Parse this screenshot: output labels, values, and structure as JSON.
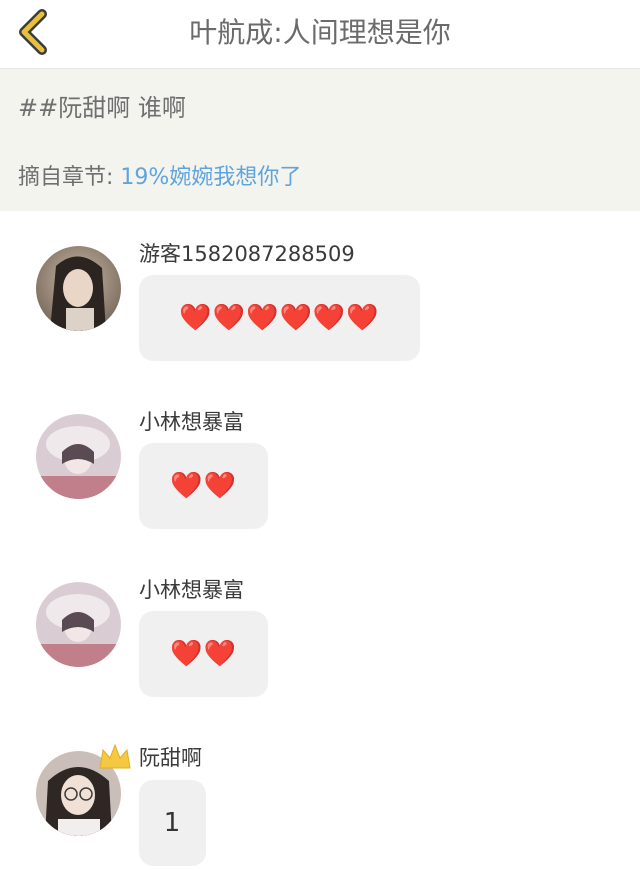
{
  "header": {
    "title": "叶航成:人间理想是你",
    "back_icon": "chevron-left-icon",
    "accent_color": "#e8c13a"
  },
  "quote": {
    "text": "##阮甜啊 谁啊",
    "chapter_label": "摘自章节:",
    "chapter_title": "19%婉婉我想你了"
  },
  "comments": [
    {
      "username": "游客1582087288509",
      "message": "❤️❤️❤️❤️❤️❤️",
      "crown": false
    },
    {
      "username": "小林想暴富",
      "message": "❤️❤️",
      "crown": false
    },
    {
      "username": "小林想暴富",
      "message": "❤️❤️",
      "crown": false
    },
    {
      "username": "阮甜啊",
      "message": "1",
      "crown": true
    }
  ]
}
